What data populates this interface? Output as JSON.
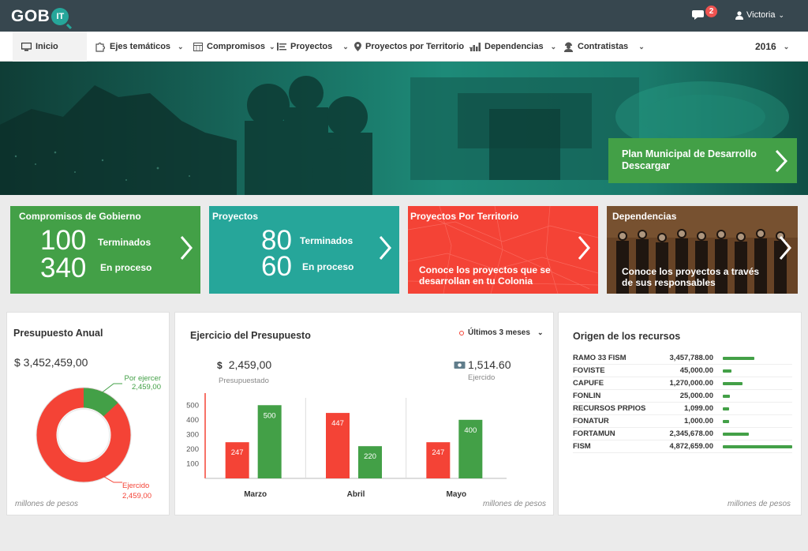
{
  "brand": {
    "name": "GOB",
    "badge": "IT"
  },
  "topbar": {
    "notifications": "2",
    "user": "Victoria"
  },
  "nav": {
    "items": [
      {
        "label": "Inicio",
        "icon": "monitor-icon"
      },
      {
        "label": "Ejes temáticos",
        "icon": "puzzle-icon"
      },
      {
        "label": "Compromisos",
        "icon": "calendar-icon"
      },
      {
        "label": "Proyectos",
        "icon": "list-icon"
      },
      {
        "label": "Proyectos por Territorio",
        "icon": "map-pin-icon"
      },
      {
        "label": "Dependencias",
        "icon": "bar-chart-icon"
      },
      {
        "label": "Contratistas",
        "icon": "worker-icon"
      }
    ],
    "year": "2016"
  },
  "banner": {
    "plan_line1": "Plan Municipal de Desarrollo",
    "plan_line2": "Descargar"
  },
  "cards": {
    "compromisos": {
      "title": "Compromisos de Gobierno",
      "n1": "100",
      "l1": "Terminados",
      "n2": "340",
      "l2": "En proceso"
    },
    "proyectos": {
      "title": "Proyectos",
      "n1": "80",
      "l1": "Terminados",
      "n2": "60",
      "l2": "En proceso"
    },
    "territorio": {
      "title": "Proyectos Por Territorio",
      "desc1": "Conoce los proyectos que se",
      "desc2": "desarrollan en tu Colonia"
    },
    "dependencias": {
      "title": "Dependencias",
      "desc1": "Conoce los proyectos a través",
      "desc2": "de sus responsables"
    }
  },
  "presupuesto": {
    "title": "Presupuesto Anual",
    "total": "$ 3,452,459,00",
    "por_ejercer_label": "Por ejercer",
    "por_ejercer_value": "2,459,00",
    "ejercido_label": "Ejercido",
    "ejercido_value": "2,459,00",
    "note": "millones de pesos"
  },
  "ejercicio": {
    "title": "Ejercicio del Presupuesto",
    "filter": "Últimos 3 meses",
    "presupuestado_value": "2,459,00",
    "presupuestado_label": "Presupuestado",
    "ejercido_value": "1,514.60",
    "ejercido_label": "Ejercido",
    "currency": "$",
    "note": "millones de pesos"
  },
  "origen": {
    "title": "Origen de los recursos",
    "rows": [
      {
        "name": "RAMO 33 FISM",
        "value": "3,457,788.00"
      },
      {
        "name": "FOVISTE",
        "value": "45,000.00"
      },
      {
        "name": "CAPUFE",
        "value": "1,270,000.00"
      },
      {
        "name": "FONLIN",
        "value": "25,000.00"
      },
      {
        "name": "RECURSOS PRPIOS",
        "value": "1,099.00"
      },
      {
        "name": "FONATUR",
        "value": "1,000.00"
      },
      {
        "name": "FORTAMUN",
        "value": "2,345,678.00"
      },
      {
        "name": "FISM",
        "value": "4,872,659.00"
      }
    ],
    "bar_fractions": [
      0.45,
      0.12,
      0.28,
      0.1,
      0.09,
      0.09,
      0.37,
      1.0
    ],
    "note": "millones de pesos"
  },
  "colors": {
    "green": "#43a047",
    "teal": "#26a69a",
    "red": "#f44336",
    "dark": "#37474f"
  },
  "chart_data": [
    {
      "type": "pie",
      "title": "Presupuesto Anual",
      "labels": [
        "Por ejercer",
        "Ejercido"
      ],
      "fractions": [
        0.13,
        0.87
      ],
      "colors": [
        "#43a047",
        "#f44336"
      ]
    },
    {
      "type": "bar",
      "title": "Ejercicio del Presupuesto",
      "categories": [
        "Marzo",
        "Abril",
        "Mayo"
      ],
      "series": [
        {
          "values": [
            247,
            447,
            247
          ],
          "color": "#f44336"
        },
        {
          "values": [
            500,
            220,
            400
          ],
          "color": "#43a047"
        }
      ],
      "yticks": [
        "500",
        "400",
        "300",
        "200",
        "100"
      ],
      "ylim": [
        0,
        550
      ]
    }
  ]
}
